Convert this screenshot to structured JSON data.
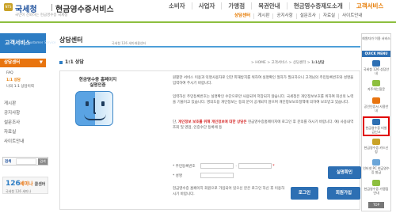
{
  "header": {
    "emblem_text": "NTS",
    "org_name": "국세청",
    "service_name": "현금영수증서비스",
    "slogan": "국민이 신뢰하는 현금영수증 국세청",
    "gnb": [
      {
        "label": "소비자",
        "active": false
      },
      {
        "label": "사업자",
        "active": false
      },
      {
        "label": "가맹점",
        "active": false
      },
      {
        "label": "복권안내",
        "active": false
      },
      {
        "label": "현금영수증제도소개",
        "active": false
      },
      {
        "label": "고객서비스",
        "active": true
      }
    ],
    "subgnb": [
      {
        "label": "상담센터",
        "active": true
      },
      {
        "label": "게시판",
        "active": false
      },
      {
        "label": "공지사항",
        "active": false
      },
      {
        "label": "설문조사",
        "active": false
      },
      {
        "label": "자료실",
        "active": false
      },
      {
        "label": "사이트안내",
        "active": false
      }
    ]
  },
  "sidebar": {
    "title": "고객서비스",
    "title_en": "Customer Service",
    "group_label": "상담센터",
    "group_arrow": "▼",
    "sub_items": [
      {
        "label": "FAQ",
        "active": false
      },
      {
        "label": "1:1 상담",
        "active": true
      },
      {
        "label": "나의 1:1 상담이력",
        "active": false
      }
    ],
    "main_items": [
      "게시판",
      "공지사항",
      "설문조사",
      "자료실",
      "사이트안내"
    ],
    "search": {
      "label": "검색",
      "placeholder": "",
      "button": "검색"
    },
    "banner": {
      "number": "126",
      "text": "세미나",
      "extra": "콜센터",
      "sub": "국세청 126 세미나"
    }
  },
  "content": {
    "page_title": "상담센터",
    "page_desc": "국세청 126 세미래콜센터",
    "breadcrumb": {
      "home": "HOME",
      "sep": ">",
      "items": [
        "고객서비스",
        "상담센터"
      ],
      "current": "1:1상담"
    },
    "section_title": "1:1 상담",
    "login_box": {
      "left_title_1": "현금영수증 홈페이지",
      "left_title_2": "실명인증",
      "para1": "원활한 서비스 이용과 익명사용자로 인한 피해방지를 위하여 실명확인 절차가 필요하오니 고객님의 주민등록번호와 성명을 입력하여 주시기 바랍니다.",
      "para2": "입력하신 주민등록번호는 실명확인 수단으로만 사용되며 저장되지 않습니다. 국세청은 개인정보보호를 위하여 최선의 노력을 기울이고 있습니다. 명의도용 개인정보는 등의 문이 공개되지 않으며 개인정보보호정책에 의하여 보호받고 있습니다.",
      "para2_warn_prefix": "단, ",
      "para2_warn": "개인정보 보호를 위해 개인정보에 대한 상담은",
      "para2_suffix": " 현금영수증홈페이지에 로그인 후 문의를 하시기 바랍니다. 예) 사용내역 조회 및 영업, 인증수단 등록에 등",
      "field_ssn_label": "* 주민등록번호",
      "field_name_label": "* 성명",
      "realname_button": "실명확인",
      "login_note": "현금영수증 홈페이지 회원으로 가입되어 있으신 분은 로그인 하신 후 이용하시기 바랍니다.",
      "login_button": "로그인",
      "join_button": "회원가입"
    }
  },
  "quick_menu": {
    "header": "회원자가 이용 서비스",
    "title": "QUICK MENU",
    "items": [
      {
        "label": "국세청 126 상담안내",
        "icon_color": "#2d6fb3",
        "highlight": false
      },
      {
        "label": "자주하는질문",
        "icon_color": "#8dbf3f",
        "highlight": false
      },
      {
        "label": "공인인증서 사용안내",
        "icon_color": "#e8740f",
        "highlight": false
      },
      {
        "label": "현금영수증 미발급신고",
        "icon_color": "#2d6fb3",
        "highlight": true
      },
      {
        "label": "현금영수증 카드신청",
        "icon_color": "#c9a227",
        "highlight": false
      },
      {
        "label": "인터넷 PC 현금영수증 발급",
        "icon_color": "#6aa5d8",
        "highlight": false
      },
      {
        "label": "현금영수증 가맹점 안내",
        "icon_color": "#8dbf3f",
        "highlight": false
      }
    ],
    "top_button": "TOP"
  }
}
